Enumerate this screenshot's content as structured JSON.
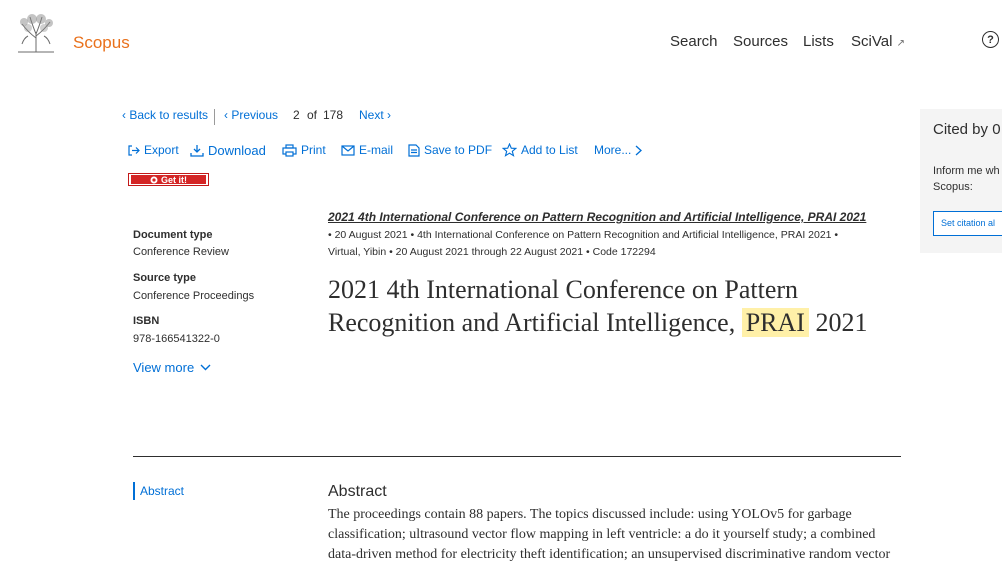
{
  "header": {
    "brand": "Scopus",
    "nav": [
      "Search",
      "Sources",
      "Lists",
      "SciVal"
    ],
    "scival_arrow": "↗",
    "help": "?"
  },
  "results_nav": {
    "back": "Back to results",
    "previous": "Previous",
    "position": "2",
    "of": "of",
    "total": "178",
    "next": "Next"
  },
  "actions": {
    "export": "Export",
    "download": "Download",
    "print": "Print",
    "email": "E-mail",
    "save_pdf": "Save to PDF",
    "add_list": "Add to List",
    "more": "More..."
  },
  "getit": {
    "label": "Get it!"
  },
  "meta": {
    "doc_type_label": "Document type",
    "doc_type_value": "Conference Review",
    "source_type_label": "Source type",
    "source_type_value": "Conference Proceedings",
    "isbn_label": "ISBN",
    "isbn_value": "978-166541322-0",
    "view_more": "View more"
  },
  "document": {
    "source_title": "2021 4th International Conference on Pattern Recognition and Artificial Intelligence, PRAI 2021",
    "meta_line1": "•  20 August 2021  •  4th International Conference on Pattern Recognition and Artificial Intelligence, PRAI 2021  •",
    "meta_line2": "Virtual, Yibin  •  20 August 2021 through 22 August 2021  •  Code 172294",
    "title_part1": "2021 4th International Conference on Pattern Recognition and Artificial Intelligence,",
    "title_highlight": "PRAI",
    "title_part2": "2021",
    "abstract_nav": "Abstract",
    "abstract_heading": "Abstract",
    "abstract_text": "The proceedings contain 88 papers. The topics discussed include: using YOLOv5 for garbage classification; ultrasound vector flow mapping in left ventricle: a do it yourself study; a combined data-driven method for electricity theft identification; an unsupervised discriminative random vector"
  },
  "side_panel": {
    "cited_by": "Cited by 0",
    "inform_line1": "Inform me wh",
    "inform_line2": "Scopus:",
    "set_alert": "Set citation al"
  },
  "colors": {
    "brand": "#e9711c",
    "link": "#006fd6",
    "highlight": "#fff0a8",
    "text": "#2e2e2e",
    "panel": "#f4f4f4"
  }
}
